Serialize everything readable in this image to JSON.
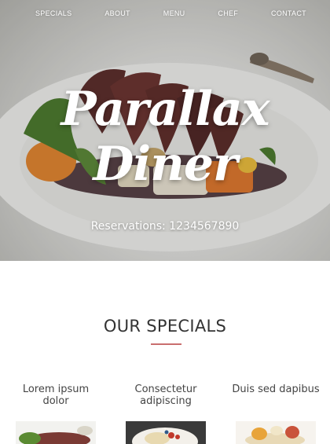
{
  "nav": {
    "items": [
      {
        "label": "SPECIALS"
      },
      {
        "label": "ABOUT"
      },
      {
        "label": "MENU"
      },
      {
        "label": "CHEF"
      },
      {
        "label": "CONTACT"
      }
    ]
  },
  "hero": {
    "title": "Parallax Diner",
    "subtitle": "Reservations: 1234567890"
  },
  "specials_section": {
    "title": "OUR SPECIALS",
    "accent_color": "#c96f6f",
    "items": [
      {
        "name": "Lorem ipsum dolor"
      },
      {
        "name": "Consectetur adipiscing"
      },
      {
        "name": "Duis sed dapibus"
      }
    ]
  }
}
